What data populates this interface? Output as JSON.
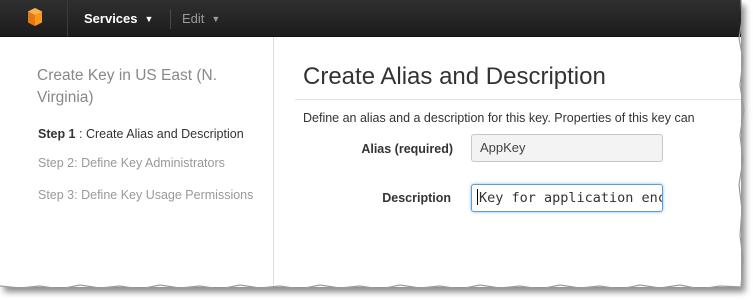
{
  "topbar": {
    "logo_icon": "aws-cube-icon",
    "services_label": "Services",
    "edit_label": "Edit",
    "caret_glyph": "⌄",
    "brand_color": "#ff9900"
  },
  "sidebar": {
    "wizard_title": "Create Key in US East (N. Virginia)",
    "steps": [
      {
        "number": "Step 1",
        "separator": " : ",
        "label": "Create Alias and Description",
        "active": true
      },
      {
        "label": "Step 2: Define Key Administrators",
        "active": false
      },
      {
        "label": "Step 3: Define Key Usage Permissions",
        "active": false
      }
    ]
  },
  "main": {
    "title": "Create Alias and Description",
    "intro": "Define an alias and a description for this key. Properties of this key can",
    "alias_label": "Alias (required)",
    "alias_value": "AppKey",
    "description_label": "Description",
    "description_value": "Key for application encryp"
  },
  "colors": {
    "topbar_bg": "#232323",
    "focus_border": "#5b9dd9"
  }
}
